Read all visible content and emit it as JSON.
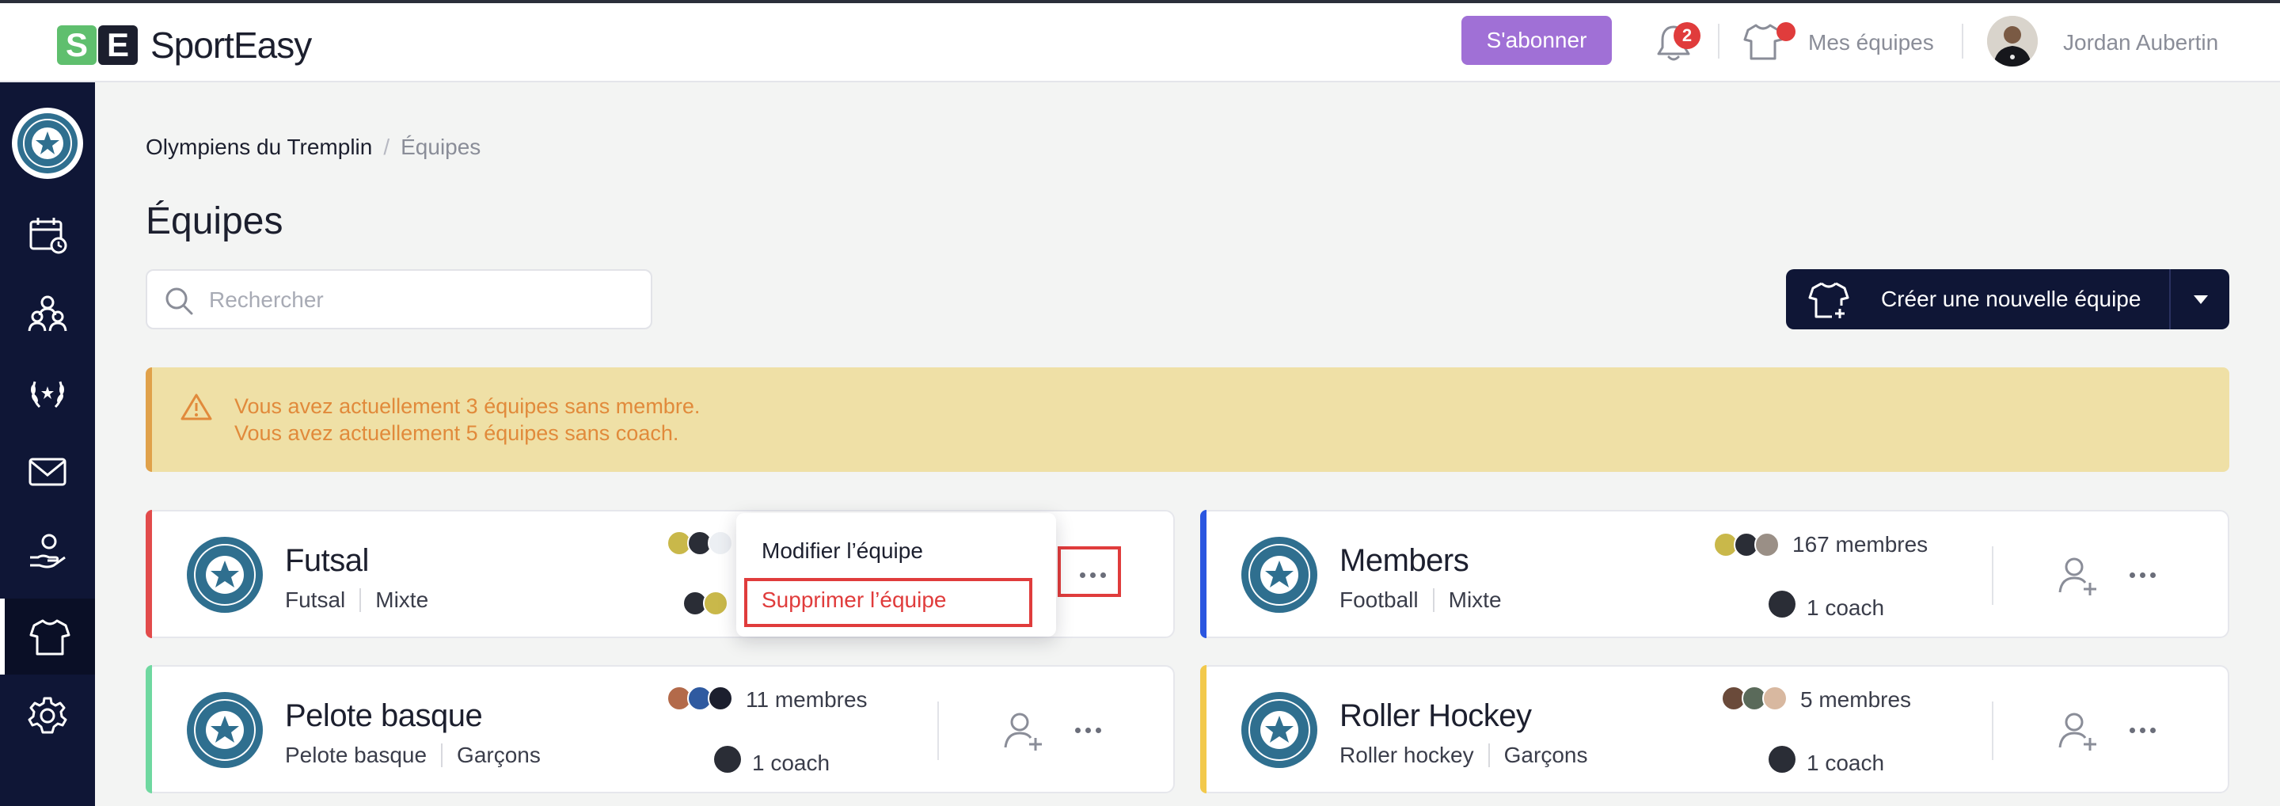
{
  "app": {
    "brand_mark": "SE",
    "brand_name": "SportEasy"
  },
  "header": {
    "subscribe_label": "S'abonner",
    "notifications_count": "2",
    "my_teams_label": "Mes équipes",
    "user_name": "Jordan Aubertin"
  },
  "sidebar": {
    "items": [
      {
        "icon": "calendar-icon"
      },
      {
        "icon": "members-icon"
      },
      {
        "icon": "laurel-icon"
      },
      {
        "icon": "mail-icon"
      },
      {
        "icon": "hand-coin-icon"
      },
      {
        "icon": "shirt-icon",
        "active": true
      },
      {
        "icon": "gear-icon"
      }
    ]
  },
  "breadcrumb": {
    "root": "Olympiens du Tremplin",
    "separator": "/",
    "current": "Équipes"
  },
  "page": {
    "title": "Équipes"
  },
  "search": {
    "placeholder": "Rechercher",
    "value": ""
  },
  "create_button": {
    "label": "Créer une nouvelle équipe"
  },
  "alert": {
    "line1": "Vous avez actuellement 3 équipes sans membre.",
    "line2": "Vous avez actuellement 5 équipes sans coach."
  },
  "teams": [
    {
      "name": "Futsal",
      "sport": "Futsal",
      "gender": "Mixte",
      "members": "",
      "coach": "",
      "accent": "#e24b4b"
    },
    {
      "name": "Members",
      "sport": "Football",
      "gender": "Mixte",
      "members": "167 membres",
      "coach": "1 coach",
      "accent": "#2a56e0"
    },
    {
      "name": "Pelote basque",
      "sport": "Pelote basque",
      "gender": "Garçons",
      "members": "11 membres",
      "coach": "1 coach",
      "accent": "#6fd8a0"
    },
    {
      "name": "Roller Hockey",
      "sport": "Roller hockey",
      "gender": "Garçons",
      "members": "5 membres",
      "coach": "1 coach",
      "accent": "#f2c94c"
    }
  ],
  "context_menu": {
    "edit_label": "Modifier l’équipe",
    "delete_label": "Supprimer l’équipe"
  }
}
